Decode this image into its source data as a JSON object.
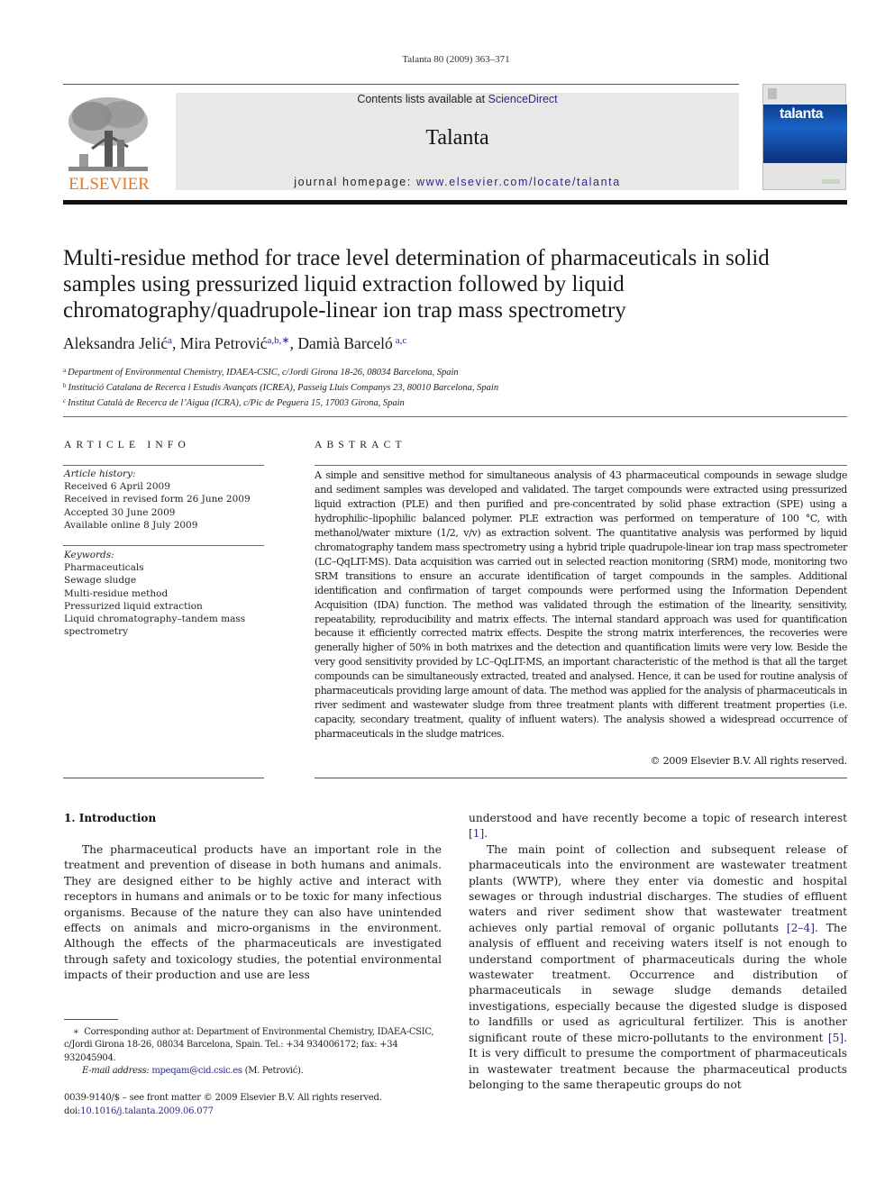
{
  "running_head": "Talanta 80 (2009) 363–371",
  "masthead": {
    "contents_prefix": "Contents lists available at ",
    "contents_link": "ScienceDirect",
    "journal_name": "Talanta",
    "homepage_prefix": "journal homepage: ",
    "homepage_link": "www.elsevier.com/locate/talanta",
    "publisher_logo_text": "ELSEVIER",
    "cover_title": "talanta",
    "colors": {
      "link": "#2a2a8a",
      "publisher_orange": "#e87722",
      "cover_blue": "#1a63c6",
      "masthead_gray": "#e8e8e8"
    }
  },
  "article": {
    "title": "Multi-residue method for trace level determination of pharmaceuticals in solid samples using pressurized liquid extraction followed by liquid chromatography/quadrupole-linear ion trap mass spectrometry",
    "authors": [
      {
        "name": "Aleksandra Jelić",
        "sup": "a"
      },
      {
        "name": "Mira Petrović",
        "sup": "a,b,∗"
      },
      {
        "name": "Damià Barceló",
        "sup": "a,c"
      }
    ],
    "author_separator": ", ",
    "affiliations": [
      {
        "key": "a",
        "text": "Department of Environmental Chemistry, IDAEA-CSIC, c/Jordi Girona 18-26, 08034 Barcelona, Spain"
      },
      {
        "key": "b",
        "text": "Institució Catalana de Recerca i Estudis Avançats (ICREA), Passeig Lluis Companys 23, 80010 Barcelona, Spain"
      },
      {
        "key": "c",
        "text": "Institut Català de Recerca de l’Aigua (ICRA), c/Pic de Peguera 15, 17003 Girona, Spain"
      }
    ]
  },
  "article_info": {
    "heading": "ARTICLE INFO",
    "history_label": "Article history:",
    "history": [
      "Received 6 April 2009",
      "Received in revised form 26 June 2009",
      "Accepted 30 June 2009",
      "Available online 8 July 2009"
    ],
    "keywords_label": "Keywords:",
    "keywords": [
      "Pharmaceuticals",
      "Sewage sludge",
      "Multi-residue method",
      "Pressurized liquid extraction",
      "Liquid chromatography–tandem mass spectrometry"
    ]
  },
  "abstract": {
    "heading": "ABSTRACT",
    "text": "A simple and sensitive method for simultaneous analysis of 43 pharmaceutical compounds in sewage sludge and sediment samples was developed and validated. The target compounds were extracted using pressurized liquid extraction (PLE) and then purified and pre-concentrated by solid phase extraction (SPE) using a hydrophilic–lipophilic balanced polymer. PLE extraction was performed on temperature of 100 °C, with methanol/water mixture (1/2, v/v) as extraction solvent. The quantitative analysis was performed by liquid chromatography tandem mass spectrometry using a hybrid triple quadrupole-linear ion trap mass spectrometer (LC–QqLIT-MS). Data acquisition was carried out in selected reaction monitoring (SRM) mode, monitoring two SRM transitions to ensure an accurate identification of target compounds in the samples. Additional identification and confirmation of target compounds were performed using the Information Dependent Acquisition (IDA) function. The method was validated through the estimation of the linearity, sensitivity, repeatability, reproducibility and matrix effects. The internal standard approach was used for quantification because it efficiently corrected matrix effects. Despite the strong matrix interferences, the recoveries were generally higher of 50% in both matrixes and the detection and quantification limits were very low. Beside the very good sensitivity provided by LC–QqLIT-MS, an important characteristic of the method is that all the target compounds can be simultaneously extracted, treated and analysed. Hence, it can be used for routine analysis of pharmaceuticals providing large amount of data. The method was applied for the analysis of pharmaceuticals in river sediment and wastewater sludge from three treatment plants with different treatment properties (i.e. capacity, secondary treatment, quality of influent waters). The analysis showed a widespread occurrence of pharmaceuticals in the sludge matrices.",
    "copyright": "© 2009 Elsevier B.V. All rights reserved."
  },
  "introduction": {
    "heading": "1.  Introduction",
    "p1": "The pharmaceutical products have an important role in the treatment and prevention of disease in both humans and animals. They are designed either to be highly active and interact with receptors in humans and animals or to be toxic for many infectious organisms. Because of the nature they can also have unintended effects on animals and micro-organisms in the environment. Although the effects of the pharmaceuticals are investigated through safety and toxicology studies, the potential environmental impacts of their production and use are less",
    "p1_cont": "understood and have recently become a topic of research interest ",
    "ref1": "[1]",
    "p2_a": "The main point of collection and subsequent release of pharmaceuticals into the environment are wastewater treatment plants (WWTP), where they enter via domestic and hospital sewages or through industrial discharges. The studies of effluent waters and river sediment show that wastewater treatment achieves only partial removal of organic pollutants ",
    "ref2": "[2–4]",
    "p2_b": ". The analysis of effluent and receiving waters itself is not enough to understand comportment of pharmaceuticals during the whole wastewater treatment. Occurrence and distribution of pharmaceuticals in sewage sludge demands detailed investigations, especially because the digested sludge is disposed to landfills or used as agricultural fertilizer. This is another significant route of these micro-pollutants to the environment ",
    "ref3": "[5]",
    "p2_c": ". It is very difficult to presume the comportment of pharmaceuticals in wastewater treatment because the pharmaceutical products belonging to the same therapeutic groups do not"
  },
  "footnote": {
    "marker": "∗",
    "text": "Corresponding author at: Department of Environmental Chemistry, IDAEA-CSIC, c/Jordi Girona 18-26, 08034 Barcelona, Spain. Tel.: +34 934006172; fax: +34 932045904.",
    "email_label": "E-mail address: ",
    "email": "mpeqam@cid.csic.es",
    "email_suffix": " (M. Petrović)."
  },
  "front_matter": {
    "issn_line": "0039-9140/$ – see front matter © 2009 Elsevier B.V. All rights reserved.",
    "doi_label": "doi:",
    "doi": "10.1016/j.talanta.2009.06.077"
  }
}
